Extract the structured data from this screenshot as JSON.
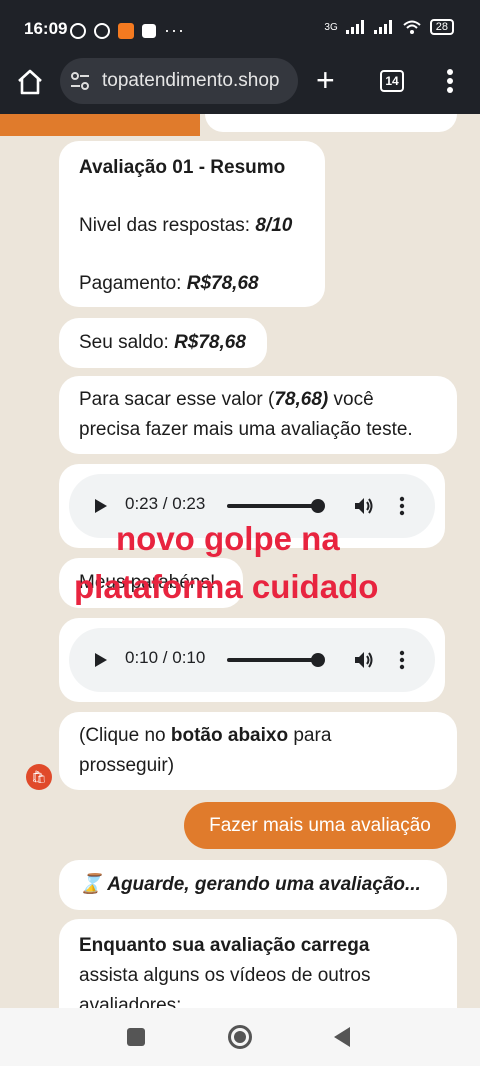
{
  "status_bar": {
    "time": "16:09",
    "dots": "···",
    "network": "3G",
    "battery": "28"
  },
  "browser": {
    "url": "topatendimento.shop",
    "tab_count": "14"
  },
  "messages": {
    "summary": {
      "title": "Avaliação 01 - Resumo",
      "level_label": "Nivel das respostas: ",
      "level_value": "8/10",
      "payment_label": "Pagamento: ",
      "payment_value": "R$78,68"
    },
    "balance": {
      "label": "Seu saldo: ",
      "value": "R$78,68"
    },
    "withdraw": {
      "text_1": "Para sacar esse valor (",
      "value": "78,68)",
      "text_2": " você",
      "text_3": "precisa fazer mais uma avaliação teste."
    },
    "audio_1": {
      "time": "0:23 / 0:23",
      "progress": 1.0
    },
    "congrats": "Meus parabéns!",
    "audio_2": {
      "time": "0:10 / 0:10",
      "progress": 1.0
    },
    "click_hint": {
      "text_1": "(Clique no ",
      "bold": "botão abaixo",
      "text_2": " para",
      "text_3": "prosseguir)"
    },
    "action_button": "Fazer mais uma avaliação",
    "waiting": "⌛ Aguarde, gerando uma avaliação...",
    "loading": {
      "bold": "Enquanto sua avaliação carrega",
      "text_1": "assista alguns os vídeos de outros",
      "text_2": "avaliadores:"
    }
  },
  "overlay": {
    "line_1": "novo golpe na",
    "line_2": "plataforma cuidado"
  },
  "colors": {
    "accent": "#e07b2c",
    "overlay_red": "#e8243f",
    "chat_bg": "#ece5da"
  }
}
